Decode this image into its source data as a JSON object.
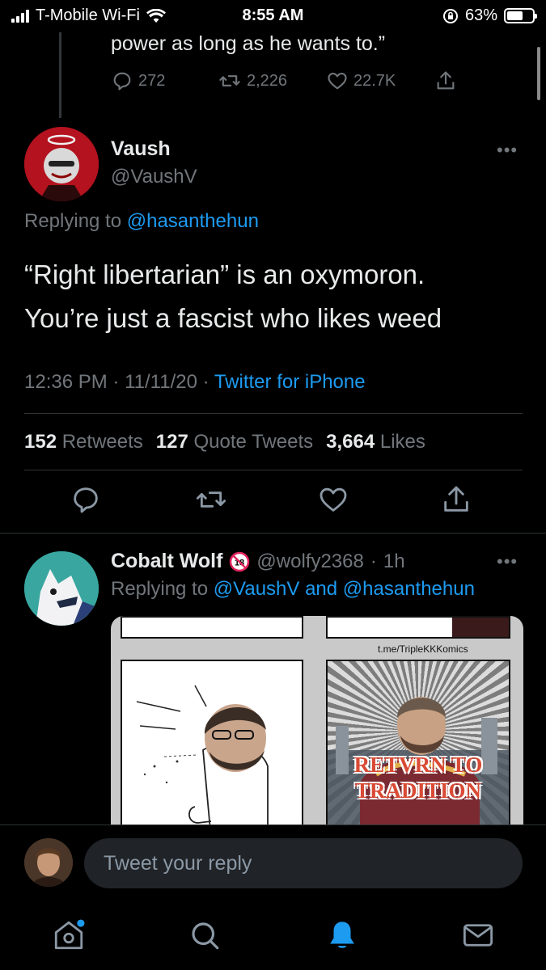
{
  "status_bar": {
    "carrier": "T-Mobile Wi-Fi",
    "time": "8:55 AM",
    "battery": "63%",
    "battery_level": 0.63
  },
  "previous_tweet": {
    "text_fragment": "power as long as he wants to.”",
    "replies": "272",
    "retweets": "2,226",
    "likes": "22.7K"
  },
  "main_tweet": {
    "author_name": "Vaush",
    "author_handle": "@VaushV",
    "replying_prefix": "Replying to",
    "replying_to": "@hasanthehun",
    "text_line1": "“Right libertarian” is an oxymoron.",
    "text_line2": "You’re just a fascist who likes weed",
    "time": "12:36 PM",
    "date": "11/11/20",
    "source": "Twitter for iPhone",
    "sep": "·",
    "retweets_count": "152",
    "retweets_label": "Retweets",
    "quotes_count": "127",
    "quotes_label": "Quote Tweets",
    "likes_count": "3,664",
    "likes_label": "Likes"
  },
  "reply_tweet": {
    "author_name": "Cobalt Wolf",
    "author_handle": "@wolfy2368",
    "time_ago": "1h",
    "sep": "·",
    "replying_prefix": "Replying to",
    "replying_to_1": "@VaushV",
    "replying_and": "and",
    "replying_to_2": "@hasanthehun",
    "comic_watermark": "t.me/TripleKKKomics",
    "comic_caption_line1": "RETVRN TO",
    "comic_caption_line2": "TRADITION"
  },
  "compose": {
    "placeholder": "Tweet your reply"
  },
  "tabbar": {
    "items": [
      "home-icon",
      "search-icon",
      "notifications-icon",
      "messages-icon"
    ],
    "active": "notifications-icon"
  },
  "colors": {
    "accent": "#1d9bf0",
    "muted": "#71767b",
    "text": "#e7e9ea",
    "background": "#000000"
  }
}
